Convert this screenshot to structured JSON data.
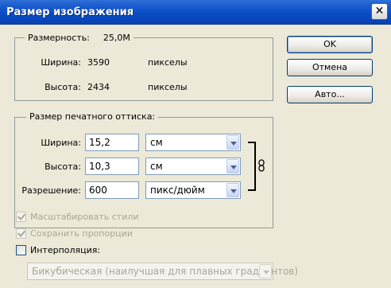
{
  "window": {
    "title": "Размер изображения",
    "close_glyph": "✕"
  },
  "pixel_dimensions": {
    "label": "Размерность:",
    "size": "25,0М",
    "width_label": "Ширина:",
    "width_value": "3590",
    "width_unit": "пикселы",
    "height_label": "Высота:",
    "height_value": "2434",
    "height_unit": "пикселы"
  },
  "document_size": {
    "legend": "Размер печатного оттиска:",
    "width_label": "Ширина:",
    "width_value": "15,2",
    "width_unit": "см",
    "height_label": "Высота:",
    "height_value": "10,3",
    "height_unit": "см",
    "resolution_label": "Разрешение:",
    "resolution_value": "600",
    "resolution_unit": "пикс/дюйм",
    "link_icon": "chain-link-icon"
  },
  "buttons": {
    "ok": "OK",
    "cancel": "Отмена",
    "auto": "Авто..."
  },
  "options": {
    "scale_styles": {
      "label": "Масштабировать стили",
      "checked": true,
      "enabled": false
    },
    "constrain": {
      "label": "Сохранить пропорции",
      "checked": true,
      "enabled": false
    },
    "resample": {
      "label": "Интерполяция:",
      "checked": false,
      "enabled": true
    },
    "resample_method": "Бикубическая (наилучшая для плавных градиентов)"
  }
}
